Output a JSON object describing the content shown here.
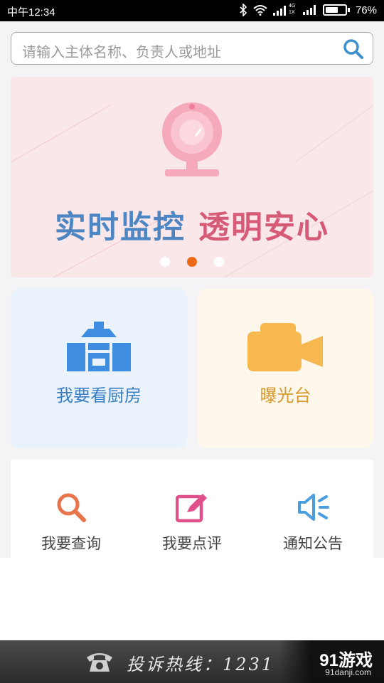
{
  "status_bar": {
    "time": "中午12:34",
    "network_small_top": "4G",
    "network_small_bottom": "1X",
    "battery": "76%",
    "battery_level": 0.76
  },
  "search": {
    "placeholder": "请输入主体名称、负责人或地址",
    "icon": "search-icon"
  },
  "banner": {
    "slogan_part1": "实时监控",
    "slogan_part2": "透明安心",
    "illustration": "webcam-icon",
    "slide_count": 3,
    "active_slide": 2
  },
  "features": [
    {
      "label": "我要看厨房",
      "icon": "kitchen-building-icon",
      "color": "#3b7ec1"
    },
    {
      "label": "曝光台",
      "icon": "video-camera-icon",
      "color": "#d8982a"
    }
  ],
  "actions": [
    {
      "label": "我要查询",
      "icon": "search-icon",
      "color": "#e8744c"
    },
    {
      "label": "我要点评",
      "icon": "edit-icon",
      "color": "#e0508a"
    },
    {
      "label": "通知公告",
      "icon": "speaker-icon",
      "color": "#4a9ee0"
    }
  ],
  "hotline": {
    "icon": "telephone-icon",
    "text": "投诉热线：1231",
    "watermark_brand": "91游戏",
    "watermark_site": "91danji.com"
  }
}
